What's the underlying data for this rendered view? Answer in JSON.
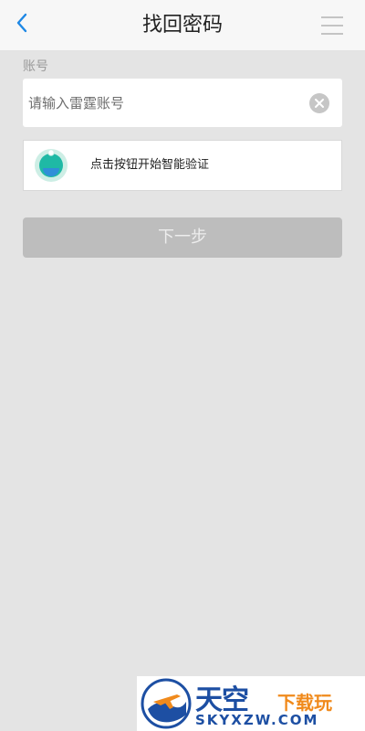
{
  "header": {
    "title": "找回密码",
    "back_icon": "chevron-left-icon",
    "menu_icon": "hamburger-menu-icon",
    "accent_color": "#1e88e5"
  },
  "form": {
    "account_label": "账号",
    "account_placeholder": "请输入雷霆账号",
    "account_value": "",
    "clear_icon": "clear-circle-icon",
    "verify_label": "点击按钮开始智能验证",
    "verify_icon": "smart-verify-icon",
    "next_label": "下一步",
    "next_enabled": false
  },
  "watermark": {
    "title": "天空",
    "subtitle": "下载玩",
    "url": "SKYXZW.COM"
  }
}
